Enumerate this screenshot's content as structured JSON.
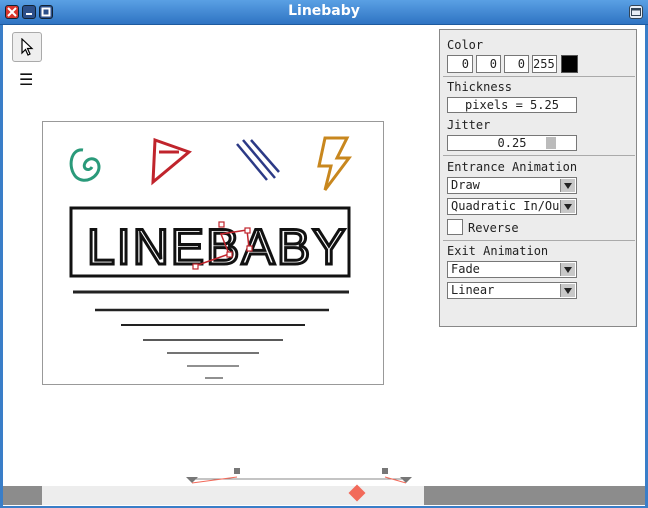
{
  "window": {
    "title": "Linebaby"
  },
  "toolbar": {
    "pointer_tool": "pointer-tool",
    "menu_icon": "☰"
  },
  "canvas": {
    "text": "LINEBABY"
  },
  "panel": {
    "color_label": "Color",
    "color_r": "0",
    "color_g": "0",
    "color_b": "0",
    "color_a": "255",
    "swatch_color": "#000000",
    "thickness_label": "Thickness",
    "thickness_value": "pixels = 5.25",
    "jitter_label": "Jitter",
    "jitter_value": "0.25",
    "entrance_label": "Entrance Animation",
    "entrance_type": "Draw",
    "entrance_easing": "Quadratic In/Out",
    "reverse_label": "Reverse",
    "exit_label": "Exit Animation",
    "exit_type": "Fade",
    "exit_easing": "Linear"
  },
  "colors": {
    "accent_red": "#c0242c",
    "green": "#2a9a7a",
    "navy": "#2c3a86",
    "orange": "#c8871e",
    "keyframe": "#f26a5a"
  }
}
